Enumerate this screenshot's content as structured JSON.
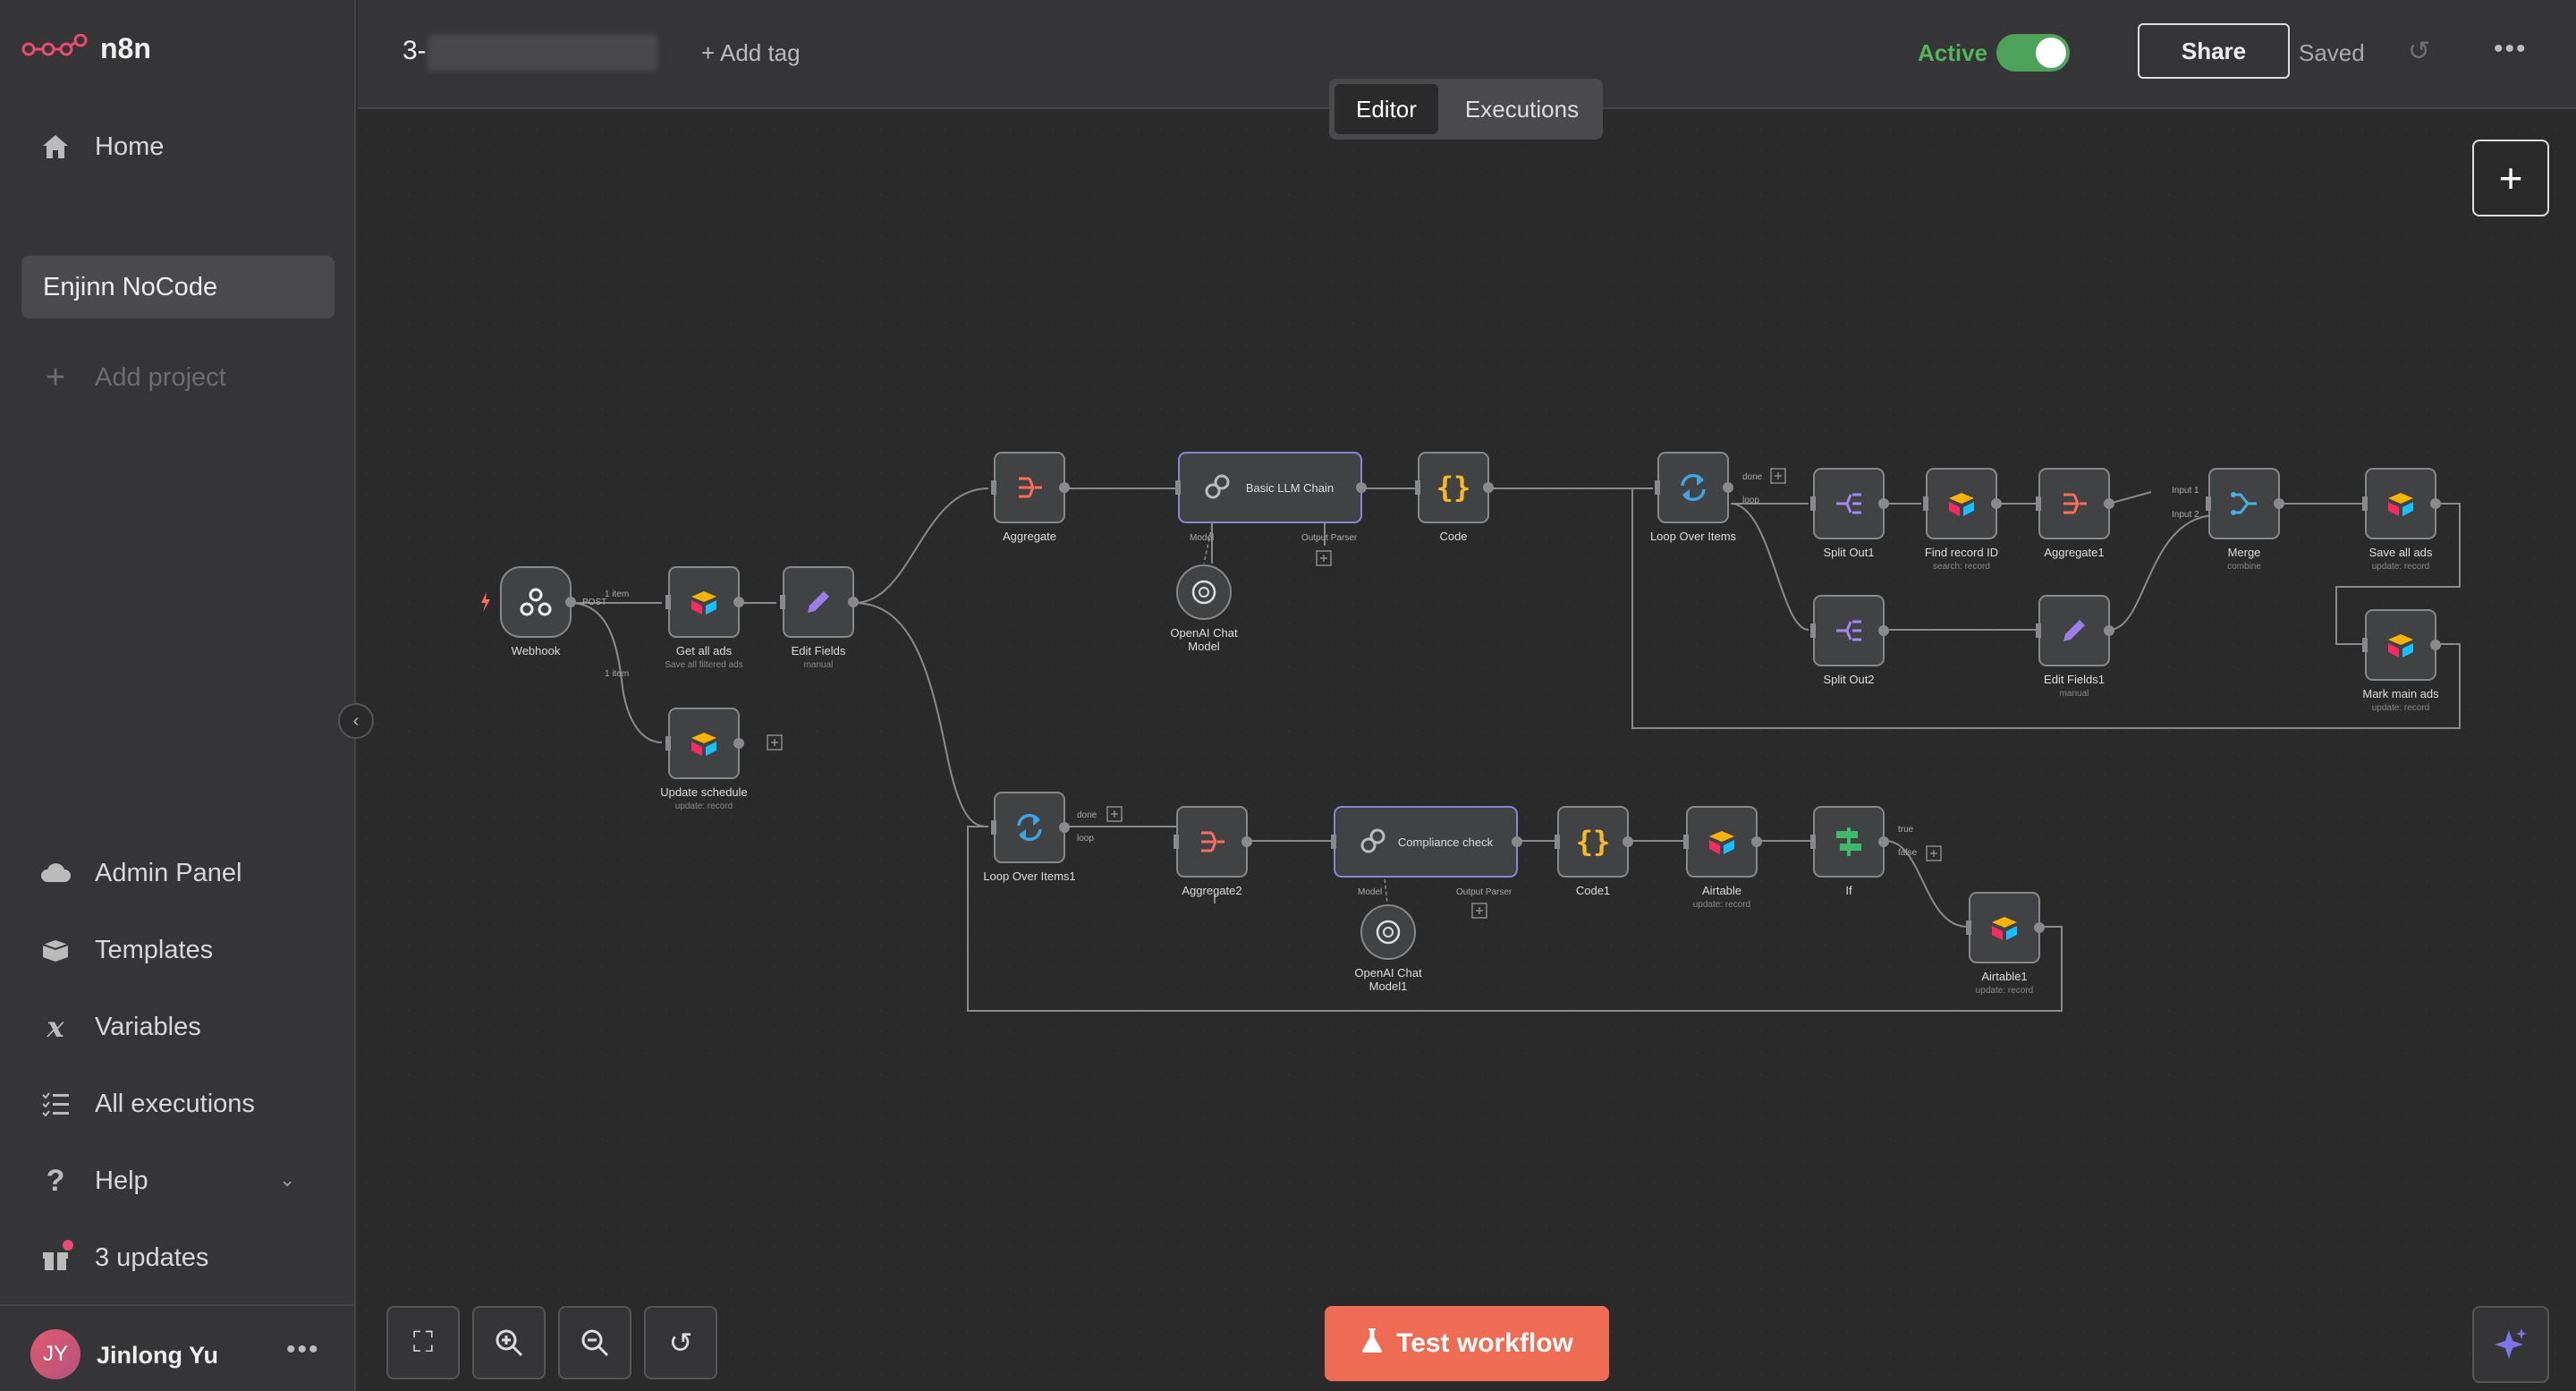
{
  "app": {
    "brand": "n8n"
  },
  "sidebar": {
    "home": "Home",
    "project": "Enjinn NoCode",
    "add_project": "Add project",
    "admin_panel": "Admin Panel",
    "templates": "Templates",
    "variables": "Variables",
    "all_executions": "All executions",
    "help": "Help",
    "updates": "3 updates",
    "user": {
      "initials": "JY",
      "name": "Jinlong Yu"
    }
  },
  "header": {
    "workflow_name": "3-",
    "add_tag": "+ Add tag",
    "active_label": "Active",
    "share": "Share",
    "saved": "Saved",
    "tabs": [
      "Editor",
      "Executions"
    ]
  },
  "canvas": {
    "test_workflow": "Test workflow",
    "nodes": [
      {
        "name": "Webhook",
        "sub": ""
      },
      {
        "name": "Get all ads",
        "sub": "Save all filtered ads"
      },
      {
        "name": "Edit Fields",
        "sub": "manual"
      },
      {
        "name": "Update schedule",
        "sub": "update: record"
      },
      {
        "name": "Aggregate",
        "sub": ""
      },
      {
        "name": "Basic LLM Chain",
        "sub": ""
      },
      {
        "name": "Code",
        "sub": ""
      },
      {
        "name": "OpenAI Chat Model",
        "sub": ""
      },
      {
        "name": "Loop Over Items",
        "sub": ""
      },
      {
        "name": "Split Out1",
        "sub": ""
      },
      {
        "name": "Find record ID",
        "sub": "search: record"
      },
      {
        "name": "Aggregate1",
        "sub": ""
      },
      {
        "name": "Merge",
        "sub": "combine"
      },
      {
        "name": "Save all ads",
        "sub": "update: record"
      },
      {
        "name": "Split Out2",
        "sub": ""
      },
      {
        "name": "Edit Fields1",
        "sub": "manual"
      },
      {
        "name": "Mark main ads",
        "sub": "update: record"
      },
      {
        "name": "Loop Over Items1",
        "sub": ""
      },
      {
        "name": "Aggregate2",
        "sub": ""
      },
      {
        "name": "Compliance check",
        "sub": ""
      },
      {
        "name": "OpenAI Chat Model1",
        "sub": ""
      },
      {
        "name": "Code1",
        "sub": ""
      },
      {
        "name": "Airtable",
        "sub": "update: record"
      },
      {
        "name": "If",
        "sub": ""
      },
      {
        "name": "Airtable1",
        "sub": "update: record"
      }
    ],
    "edge_labels": {
      "one_item": "1 item",
      "post": "POST",
      "done": "done",
      "loop": "loop",
      "model": "Model",
      "output_parser": "Output Parser",
      "input1": "Input 1",
      "input2": "Input 2",
      "true": "true",
      "false": "false"
    }
  },
  "colors": {
    "accent": "#ee6b54",
    "active": "#55b25e",
    "node_bg": "#414244"
  }
}
